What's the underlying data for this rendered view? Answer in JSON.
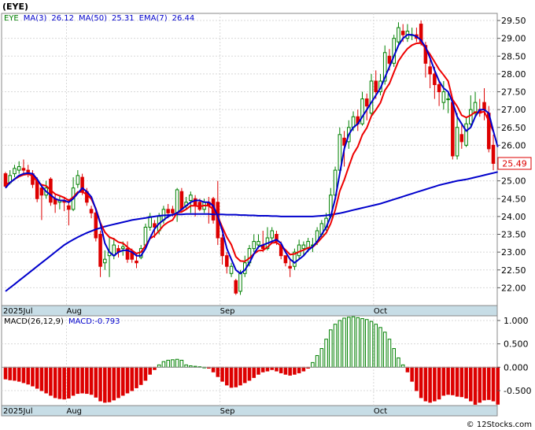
{
  "symbol": "(EYE)",
  "legend_top": [
    {
      "text": "EYE",
      "color": "#008000"
    },
    {
      "text": "MA(3)",
      "color": "#0000cc"
    },
    {
      "text": "26.12",
      "color": "#0000cc"
    },
    {
      "text": "MA(50)",
      "color": "#0000cc"
    },
    {
      "text": "25.31",
      "color": "#0000cc"
    },
    {
      "text": "EMA(7)",
      "color": "#0000cc"
    },
    {
      "text": "26.44",
      "color": "#0000cc"
    }
  ],
  "legend_macd": [
    {
      "text": "MACD(26,12,9)",
      "color": "#000000"
    },
    {
      "text": "MACD:-0.793",
      "color": "#0000cc"
    }
  ],
  "last_price_label": "25.49",
  "watermark": "© 12Stocks.com",
  "month_labels": [
    {
      "label": "2025Jul",
      "idx": 0
    },
    {
      "label": "Aug",
      "idx": 14
    },
    {
      "label": "Sep",
      "idx": 48
    },
    {
      "label": "Oct",
      "idx": 82
    }
  ],
  "chart_data": [
    {
      "type": "candlestick",
      "ylim": [
        21.5,
        29.7
      ],
      "y_ticks": [
        "22.00",
        "22.50",
        "23.00",
        "23.50",
        "24.00",
        "24.50",
        "25.00",
        "25.50",
        "26.00",
        "26.50",
        "27.00",
        "27.50",
        "28.00",
        "28.50",
        "29.00",
        "29.50"
      ],
      "colors": {
        "up": "#008000",
        "down": "#dd0000",
        "ma3": "#0000cc",
        "ma50": "#0000cc",
        "ema7": "#ee0000"
      },
      "candles": [
        [
          25.2,
          24.85,
          25.25,
          24.8
        ],
        [
          24.95,
          25.15,
          25.3,
          24.9
        ],
        [
          25.2,
          25.35,
          25.45,
          25.1
        ],
        [
          25.3,
          25.4,
          25.55,
          25.2
        ],
        [
          25.35,
          25.3,
          25.6,
          25.15
        ],
        [
          25.3,
          25.25,
          25.45,
          25.1
        ],
        [
          25.2,
          24.9,
          25.3,
          24.8
        ],
        [
          25.0,
          24.5,
          25.1,
          24.4
        ],
        [
          24.8,
          24.6,
          24.9,
          23.9
        ],
        [
          24.6,
          24.8,
          25.0,
          24.5
        ],
        [
          25.05,
          24.4,
          25.1,
          24.3
        ],
        [
          24.5,
          24.35,
          24.65,
          24.1
        ],
        [
          24.4,
          24.45,
          24.6,
          24.2
        ],
        [
          24.45,
          24.4,
          24.55,
          24.15
        ],
        [
          24.3,
          24.2,
          24.4,
          23.75
        ],
        [
          24.2,
          24.8,
          25.1,
          24.15
        ],
        [
          24.9,
          25.15,
          25.3,
          24.8
        ],
        [
          25.1,
          24.7,
          25.2,
          24.6
        ],
        [
          24.7,
          24.4,
          24.8,
          24.3
        ],
        [
          24.2,
          24.1,
          24.3,
          23.95
        ],
        [
          24.1,
          23.4,
          24.2,
          23.3
        ],
        [
          23.5,
          22.6,
          23.6,
          22.3
        ],
        [
          22.7,
          22.8,
          23.05,
          22.5
        ],
        [
          22.9,
          23.0,
          23.4,
          22.3
        ],
        [
          22.9,
          23.2,
          23.4,
          22.8
        ],
        [
          23.1,
          23.0,
          23.2,
          22.85
        ],
        [
          23.1,
          23.15,
          23.3,
          22.9
        ],
        [
          23.1,
          22.8,
          23.3,
          22.7
        ],
        [
          23.0,
          22.8,
          23.1,
          22.7
        ],
        [
          22.75,
          22.7,
          22.95,
          22.55
        ],
        [
          22.85,
          23.1,
          23.2,
          22.8
        ],
        [
          23.2,
          23.7,
          23.8,
          23.1
        ],
        [
          23.7,
          24.0,
          24.1,
          23.6
        ],
        [
          23.8,
          23.7,
          23.9,
          23.4
        ],
        [
          23.6,
          24.0,
          24.1,
          23.5
        ],
        [
          23.9,
          24.2,
          24.3,
          23.8
        ],
        [
          24.2,
          24.1,
          24.35,
          23.95
        ],
        [
          24.2,
          24.1,
          24.3,
          24.0
        ],
        [
          24.1,
          24.75,
          24.8,
          23.85
        ],
        [
          24.7,
          24.2,
          24.8,
          24.1
        ],
        [
          24.3,
          24.4,
          24.55,
          24.2
        ],
        [
          24.45,
          24.6,
          24.7,
          24.1
        ],
        [
          24.5,
          24.3,
          24.6,
          24.0
        ],
        [
          24.4,
          24.2,
          24.5,
          24.15
        ],
        [
          24.2,
          24.4,
          24.5,
          24.1
        ],
        [
          24.4,
          24.3,
          24.55,
          23.8
        ],
        [
          24.5,
          23.9,
          24.55,
          23.8
        ],
        [
          24.4,
          23.4,
          25.0,
          23.2
        ],
        [
          23.4,
          22.9,
          23.5,
          22.65
        ],
        [
          22.9,
          22.6,
          23.0,
          22.4
        ],
        [
          22.4,
          22.6,
          22.7,
          22.3
        ],
        [
          22.2,
          21.85,
          22.25,
          21.8
        ],
        [
          21.9,
          22.4,
          22.5,
          21.8
        ],
        [
          22.4,
          22.7,
          22.9,
          22.3
        ],
        [
          22.7,
          23.1,
          23.2,
          22.6
        ],
        [
          23.1,
          23.3,
          23.5,
          23.0
        ],
        [
          23.2,
          23.3,
          23.5,
          23.1
        ],
        [
          23.2,
          23.1,
          23.6,
          23.0
        ],
        [
          23.1,
          23.4,
          23.7,
          23.05
        ],
        [
          23.4,
          23.6,
          23.7,
          23.3
        ],
        [
          23.5,
          23.3,
          23.6,
          23.2
        ],
        [
          23.2,
          22.9,
          23.3,
          22.8
        ],
        [
          22.9,
          22.7,
          22.9,
          22.6
        ],
        [
          22.6,
          22.55,
          22.8,
          22.3
        ],
        [
          22.6,
          23.0,
          23.1,
          22.5
        ],
        [
          22.9,
          23.2,
          23.35,
          22.8
        ],
        [
          23.1,
          23.2,
          23.3,
          22.9
        ],
        [
          23.1,
          23.3,
          23.4,
          23.0
        ],
        [
          23.2,
          23.2,
          23.4,
          23.0
        ],
        [
          23.3,
          23.6,
          23.7,
          23.2
        ],
        [
          23.5,
          23.8,
          23.9,
          23.4
        ],
        [
          23.7,
          23.95,
          24.1,
          23.6
        ],
        [
          24.0,
          24.6,
          24.8,
          23.95
        ],
        [
          24.6,
          25.3,
          25.4,
          24.55
        ],
        [
          25.3,
          26.3,
          26.5,
          25.2
        ],
        [
          26.2,
          26.0,
          26.4,
          25.4
        ],
        [
          26.1,
          26.5,
          26.7,
          25.9
        ],
        [
          26.5,
          26.8,
          26.95,
          26.4
        ],
        [
          26.8,
          26.6,
          27.0,
          26.4
        ],
        [
          26.6,
          27.3,
          27.5,
          26.55
        ],
        [
          27.3,
          27.1,
          27.45,
          26.7
        ],
        [
          26.9,
          27.8,
          28.0,
          26.8
        ],
        [
          27.8,
          27.5,
          28.1,
          27.3
        ],
        [
          27.5,
          27.8,
          28.0,
          27.4
        ],
        [
          27.8,
          28.6,
          28.8,
          27.7
        ],
        [
          28.5,
          28.3,
          28.7,
          28.1
        ],
        [
          28.3,
          29.0,
          29.1,
          28.2
        ],
        [
          28.9,
          29.3,
          29.45,
          28.8
        ],
        [
          29.2,
          29.1,
          29.4,
          28.9
        ],
        [
          29.0,
          29.2,
          29.4,
          28.9
        ],
        [
          29.1,
          29.1,
          29.3,
          28.95
        ],
        [
          29.1,
          29.0,
          29.3,
          28.9
        ],
        [
          29.4,
          28.9,
          29.5,
          28.8
        ],
        [
          28.8,
          28.3,
          28.9,
          27.9
        ],
        [
          28.2,
          28.0,
          28.4,
          27.6
        ],
        [
          28.0,
          27.7,
          28.2,
          27.3
        ],
        [
          27.7,
          27.5,
          27.8,
          27.1
        ],
        [
          27.2,
          27.5,
          27.8,
          27.0
        ],
        [
          27.3,
          27.3,
          27.5,
          26.9
        ],
        [
          27.2,
          25.7,
          27.3,
          25.6
        ],
        [
          25.7,
          26.5,
          26.9,
          25.6
        ],
        [
          26.3,
          26.1,
          26.6,
          25.9
        ],
        [
          26.0,
          26.6,
          26.8,
          25.95
        ],
        [
          26.6,
          27.0,
          27.4,
          26.5
        ],
        [
          26.9,
          27.2,
          27.5,
          26.8
        ],
        [
          27.0,
          26.9,
          27.3,
          26.8
        ],
        [
          27.2,
          27.0,
          27.6,
          26.7
        ],
        [
          26.9,
          25.9,
          27.1,
          25.8
        ],
        [
          26.0,
          25.49,
          26.3,
          25.3
        ]
      ],
      "ma3": [
        24.8,
        24.95,
        25.05,
        25.15,
        25.2,
        25.22,
        25.2,
        25.05,
        24.85,
        24.7,
        24.6,
        24.5,
        24.45,
        24.45,
        24.4,
        24.5,
        24.65,
        24.8,
        24.7,
        24.55,
        24.2,
        23.8,
        23.25,
        23.0,
        22.9,
        23.0,
        23.05,
        23.05,
        23.0,
        22.9,
        22.9,
        23.1,
        23.4,
        23.65,
        23.8,
        23.9,
        24.0,
        24.05,
        24.1,
        24.2,
        24.3,
        24.4,
        24.45,
        24.45,
        24.4,
        24.4,
        24.3,
        24.0,
        23.6,
        23.1,
        22.8,
        22.5,
        22.4,
        22.5,
        22.7,
        22.95,
        23.15,
        23.2,
        23.25,
        23.3,
        23.35,
        23.25,
        23.0,
        22.8,
        22.7,
        22.8,
        22.9,
        23.05,
        23.15,
        23.3,
        23.5,
        23.7,
        24.0,
        24.5,
        25.2,
        25.9,
        26.3,
        26.5,
        26.6,
        26.8,
        27.0,
        27.2,
        27.4,
        27.6,
        27.9,
        28.2,
        28.5,
        28.8,
        29.0,
        29.1,
        29.1,
        29.05,
        28.95,
        28.75,
        28.45,
        28.1,
        27.8,
        27.6,
        27.5,
        27.2,
        26.8,
        26.6,
        26.4,
        26.5,
        26.8,
        27.0,
        27.0,
        26.9,
        26.4,
        25.95
      ],
      "ma50": [
        21.9,
        22.0,
        22.1,
        22.2,
        22.3,
        22.4,
        22.5,
        22.6,
        22.7,
        22.8,
        22.9,
        23.0,
        23.1,
        23.2,
        23.28,
        23.35,
        23.42,
        23.48,
        23.54,
        23.59,
        23.64,
        23.68,
        23.72,
        23.75,
        23.78,
        23.81,
        23.84,
        23.87,
        23.9,
        23.92,
        23.94,
        23.96,
        23.98,
        24.0,
        24.02,
        24.03,
        24.04,
        24.05,
        24.06,
        24.06,
        24.07,
        24.07,
        24.07,
        24.07,
        24.07,
        24.07,
        24.06,
        24.06,
        24.06,
        24.05,
        24.05,
        24.05,
        24.04,
        24.04,
        24.03,
        24.03,
        24.02,
        24.02,
        24.02,
        24.01,
        24.01,
        24.0,
        24.0,
        24.0,
        24.0,
        24.0,
        24.0,
        24.0,
        24.0,
        24.01,
        24.02,
        24.03,
        24.05,
        24.07,
        24.09,
        24.12,
        24.15,
        24.18,
        24.21,
        24.24,
        24.27,
        24.3,
        24.33,
        24.36,
        24.4,
        24.44,
        24.48,
        24.52,
        24.56,
        24.6,
        24.64,
        24.68,
        24.72,
        24.76,
        24.8,
        24.84,
        24.88,
        24.91,
        24.94,
        24.97,
        25.0,
        25.02,
        25.04,
        25.07,
        25.1,
        25.13,
        25.16,
        25.19,
        25.22,
        25.25
      ],
      "ema7": [
        24.9,
        24.95,
        25.05,
        25.12,
        25.17,
        25.19,
        25.14,
        24.98,
        24.89,
        24.86,
        24.74,
        24.63,
        24.58,
        24.53,
        24.45,
        24.54,
        24.69,
        24.69,
        24.62,
        24.49,
        24.22,
        23.82,
        23.56,
        23.42,
        23.37,
        23.28,
        23.25,
        23.14,
        23.05,
        22.96,
        23.0,
        23.18,
        23.38,
        23.46,
        23.6,
        23.75,
        23.84,
        23.9,
        24.11,
        24.13,
        24.2,
        24.3,
        24.3,
        24.28,
        24.31,
        24.3,
        24.2,
        24.0,
        23.7,
        23.42,
        23.21,
        22.87,
        22.75,
        22.74,
        22.83,
        22.95,
        23.04,
        23.05,
        23.14,
        23.26,
        23.27,
        23.18,
        23.06,
        22.93,
        22.95,
        23.01,
        23.06,
        23.12,
        23.14,
        23.26,
        23.4,
        23.54,
        23.8,
        24.18,
        24.71,
        25.03,
        25.4,
        25.75,
        25.96,
        26.29,
        26.49,
        26.82,
        26.99,
        27.19,
        27.54,
        27.73,
        28.05,
        28.36,
        28.55,
        28.71,
        28.81,
        28.86,
        28.87,
        28.73,
        28.55,
        28.34,
        28.13,
        27.97,
        27.8,
        27.28,
        27.09,
        26.84,
        26.78,
        26.84,
        26.93,
        26.92,
        26.94,
        26.68,
        26.39
      ]
    },
    {
      "type": "bar",
      "name": "MACD",
      "ylim": [
        -0.82,
        1.1
      ],
      "y_ticks": [
        "1.000",
        "0.500",
        "0.000",
        "-0.500"
      ],
      "colors": {
        "positive": "#008000",
        "negative": "#dd0000"
      },
      "values": [
        -0.25,
        -0.27,
        -0.28,
        -0.3,
        -0.33,
        -0.36,
        -0.4,
        -0.45,
        -0.5,
        -0.55,
        -0.6,
        -0.65,
        -0.67,
        -0.68,
        -0.66,
        -0.6,
        -0.56,
        -0.55,
        -0.56,
        -0.58,
        -0.64,
        -0.72,
        -0.75,
        -0.74,
        -0.7,
        -0.65,
        -0.6,
        -0.55,
        -0.5,
        -0.44,
        -0.37,
        -0.28,
        -0.15,
        -0.05,
        0.05,
        0.12,
        0.15,
        0.16,
        0.17,
        0.15,
        0.05,
        0.03,
        0.02,
        0.01,
        0.0,
        -0.02,
        -0.1,
        -0.2,
        -0.3,
        -0.38,
        -0.43,
        -0.42,
        -0.38,
        -0.33,
        -0.28,
        -0.22,
        -0.15,
        -0.1,
        -0.08,
        -0.05,
        -0.08,
        -0.12,
        -0.15,
        -0.17,
        -0.15,
        -0.12,
        -0.08,
        -0.02,
        0.1,
        0.25,
        0.4,
        0.6,
        0.8,
        0.92,
        1.0,
        1.05,
        1.07,
        1.08,
        1.06,
        1.04,
        1.02,
        0.98,
        0.92,
        0.85,
        0.75,
        0.6,
        0.4,
        0.2,
        0.05,
        -0.1,
        -0.3,
        -0.5,
        -0.65,
        -0.72,
        -0.75,
        -0.72,
        -0.68,
        -0.6,
        -0.58,
        -0.59,
        -0.62,
        -0.63,
        -0.66,
        -0.72,
        -0.793,
        -0.75,
        -0.7,
        -0.69,
        -0.72,
        -0.79
      ]
    }
  ]
}
